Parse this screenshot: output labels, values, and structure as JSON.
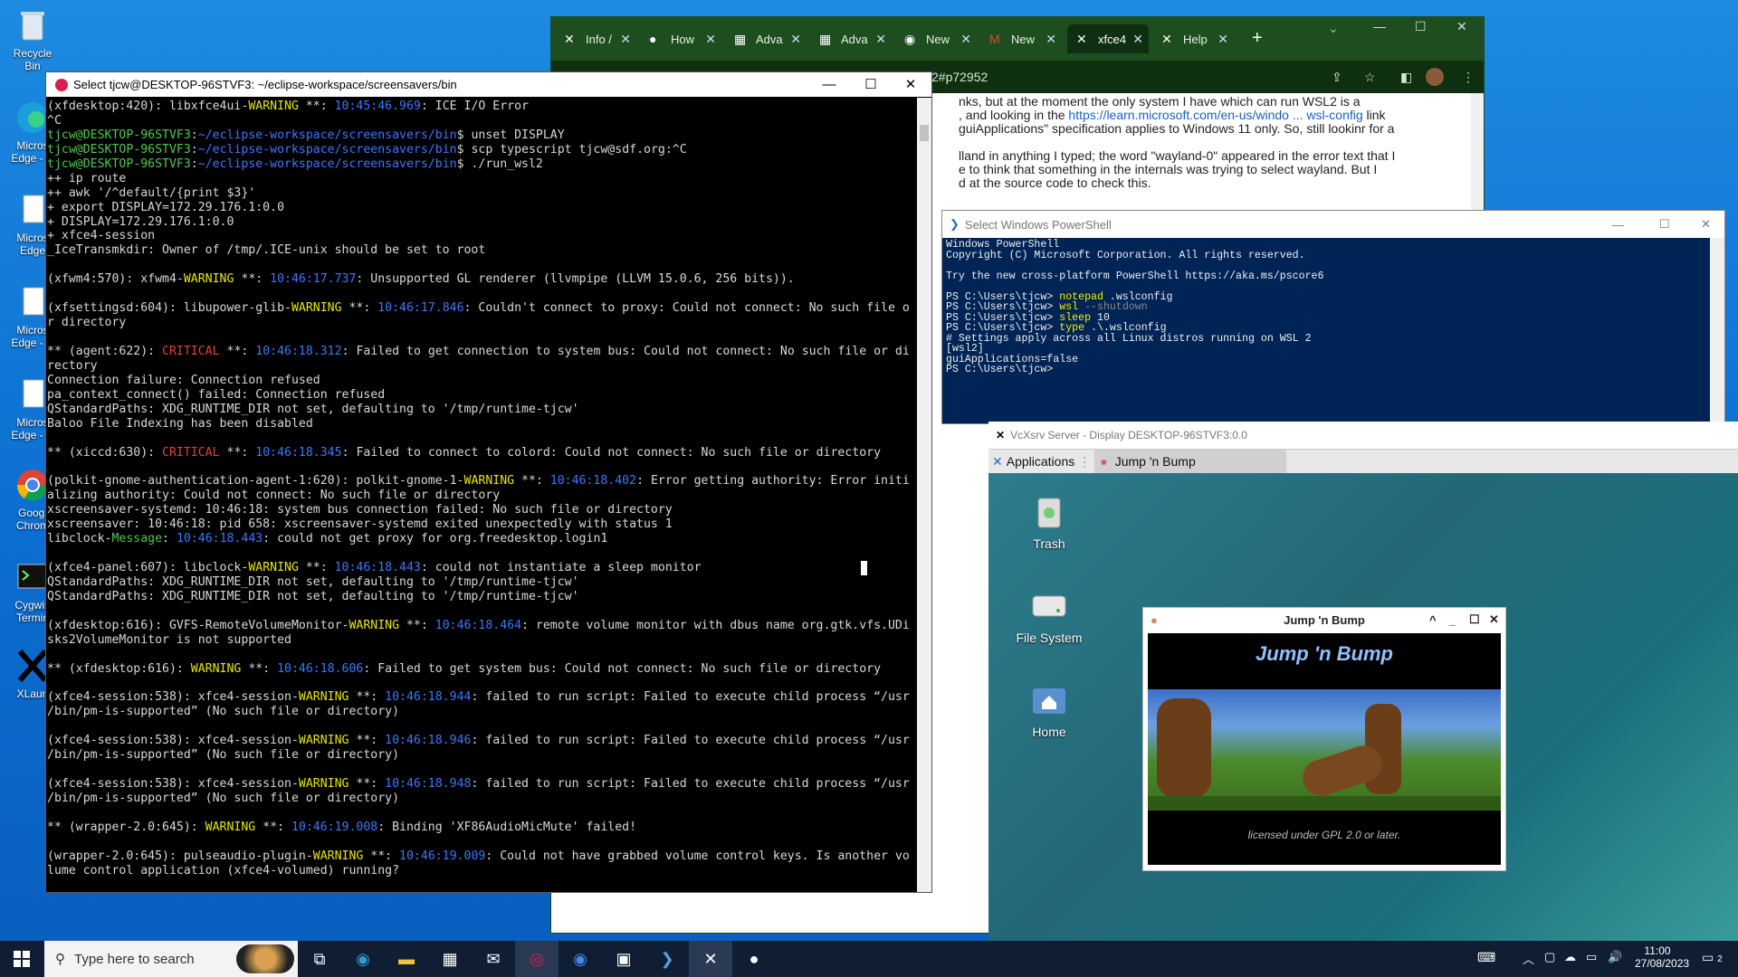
{
  "desktop": {
    "icons": [
      {
        "label": "Recycle Bin"
      },
      {
        "label": "Micros Edge - C"
      },
      {
        "label": "Micros Edge"
      },
      {
        "label": "Micros Edge - C"
      },
      {
        "label": "Micros Edge - C"
      },
      {
        "label": "Googl Chrom"
      },
      {
        "label": "Cygwin Termin"
      },
      {
        "label": "XLaun"
      }
    ]
  },
  "browser": {
    "tabs": [
      {
        "label": "Info /",
        "icon": "xfce-icon"
      },
      {
        "label": "How",
        "icon": "github-icon"
      },
      {
        "label": "Adva",
        "icon": "microsoft-icon"
      },
      {
        "label": "Adva",
        "icon": "microsoft-icon"
      },
      {
        "label": "New",
        "icon": "chrome-icon"
      },
      {
        "label": "New",
        "icon": "gmail-icon"
      },
      {
        "label": "xfce4",
        "icon": "xfce-icon"
      },
      {
        "label": "Help",
        "icon": "xfce-icon"
      }
    ],
    "address": "2#p72952",
    "content_lines": [
      "nks, but at the moment the only system I have which can run WSL2 is a",
      ", and looking in the",
      "https://learn.microsoft.com/en-us/windo ... wsl-config",
      "link",
      "guiApplications\" specification applies to Windows 11 only. So, still lookinr for a",
      "",
      "lland in anything I typed; the word \"wayland-0\" appeared in the error text that I",
      "e to think that something in the internals was trying to select wayland. But I",
      "d at the source code to check this."
    ]
  },
  "terminal": {
    "title": "Select tjcw@DESKTOP-96STVF3: ~/eclipse-workspace/screensavers/bin",
    "lines": [
      {
        "t": "(xfdesktop:420): libxfce4ui-WARNING **: 10:45:46.969: ICE I/O Error"
      },
      {
        "t": "^C"
      },
      {
        "t": "tjcw@DESKTOP-96STVF3:~/eclipse-workspace/screensavers/bin$ unset DISPLAY"
      },
      {
        "t": "tjcw@DESKTOP-96STVF3:~/eclipse-workspace/screensavers/bin$ scp typescript tjcw@sdf.org:^C"
      },
      {
        "t": "tjcw@DESKTOP-96STVF3:~/eclipse-workspace/screensavers/bin$ ./run_wsl2"
      },
      {
        "t": "++ ip route"
      },
      {
        "t": "++ awk '/^default/{print $3}'"
      },
      {
        "t": "+ export DISPLAY=172.29.176.1:0.0"
      },
      {
        "t": "+ DISPLAY=172.29.176.1:0.0"
      },
      {
        "t": "+ xfce4-session"
      },
      {
        "t": "_IceTransmkdir: Owner of /tmp/.ICE-unix should be set to root"
      },
      {
        "t": ""
      },
      {
        "t": "(xfwm4:570): xfwm4-WARNING **: 10:46:17.737: Unsupported GL renderer (llvmpipe (LLVM 15.0.6, 256 bits))."
      },
      {
        "t": ""
      },
      {
        "t": "(xfsettingsd:604): libupower-glib-WARNING **: 10:46:17.846: Couldn't connect to proxy: Could not connect: No such file o"
      },
      {
        "t": "r directory"
      },
      {
        "t": ""
      },
      {
        "t": "** (agent:622): CRITICAL **: 10:46:18.312: Failed to get connection to system bus: Could not connect: No such file or di"
      },
      {
        "t": "rectory"
      },
      {
        "t": "Connection failure: Connection refused"
      },
      {
        "t": "pa_context_connect() failed: Connection refused"
      },
      {
        "t": "QStandardPaths: XDG_RUNTIME_DIR not set, defaulting to '/tmp/runtime-tjcw'"
      },
      {
        "t": "Baloo File Indexing has been disabled"
      },
      {
        "t": ""
      },
      {
        "t": "** (xiccd:630): CRITICAL **: 10:46:18.345: Failed to connect to colord: Could not connect: No such file or directory"
      },
      {
        "t": ""
      },
      {
        "t": "(polkit-gnome-authentication-agent-1:620): polkit-gnome-1-WARNING **: 10:46:18.402: Error getting authority: Error initi"
      },
      {
        "t": "alizing authority: Could not connect: No such file or directory"
      },
      {
        "t": "xscreensaver-systemd: 10:46:18: system bus connection failed: No such file or directory"
      },
      {
        "t": "xscreensaver: 10:46:18: pid 658: xscreensaver-systemd exited unexpectedly with status 1"
      },
      {
        "t": "libclock-Message: 10:46:18.443: could not get proxy for org.freedesktop.login1"
      },
      {
        "t": ""
      },
      {
        "t": "(xfce4-panel:607): libclock-WARNING **: 10:46:18.443: could not instantiate a sleep monitor"
      },
      {
        "t": "QStandardPaths: XDG_RUNTIME_DIR not set, defaulting to '/tmp/runtime-tjcw'"
      },
      {
        "t": "QStandardPaths: XDG_RUNTIME_DIR not set, defaulting to '/tmp/runtime-tjcw'"
      },
      {
        "t": ""
      },
      {
        "t": "(xfdesktop:616): GVFS-RemoteVolumeMonitor-WARNING **: 10:46:18.464: remote volume monitor with dbus name org.gtk.vfs.UDi"
      },
      {
        "t": "sks2VolumeMonitor is not supported"
      },
      {
        "t": ""
      },
      {
        "t": "** (xfdesktop:616): WARNING **: 10:46:18.606: Failed to get system bus: Could not connect: No such file or directory"
      },
      {
        "t": ""
      },
      {
        "t": "(xfce4-session:538): xfce4-session-WARNING **: 10:46:18.944: failed to run script: Failed to execute child process “/usr"
      },
      {
        "t": "/bin/pm-is-supported” (No such file or directory)"
      },
      {
        "t": ""
      },
      {
        "t": "(xfce4-session:538): xfce4-session-WARNING **: 10:46:18.946: failed to run script: Failed to execute child process “/usr"
      },
      {
        "t": "/bin/pm-is-supported” (No such file or directory)"
      },
      {
        "t": ""
      },
      {
        "t": "(xfce4-session:538): xfce4-session-WARNING **: 10:46:18.948: failed to run script: Failed to execute child process “/usr"
      },
      {
        "t": "/bin/pm-is-supported” (No such file or directory)"
      },
      {
        "t": ""
      },
      {
        "t": "** (wrapper-2.0:645): WARNING **: 10:46:19.008: Binding 'XF86AudioMicMute' failed!"
      },
      {
        "t": ""
      },
      {
        "t": "(wrapper-2.0:645): pulseaudio-plugin-WARNING **: 10:46:19.009: Could not have grabbed volume control keys. Is another vo"
      },
      {
        "t": "lume control application (xfce4-volumed) running?"
      }
    ]
  },
  "powershell": {
    "title": "Select Windows PowerShell",
    "lines": [
      "Windows PowerShell",
      "Copyright (C) Microsoft Corporation. All rights reserved.",
      "",
      "Try the new cross-platform PowerShell https://aka.ms/pscore6",
      "",
      "PS C:\\Users\\tjcw> notepad .wslconfig",
      "PS C:\\Users\\tjcw> wsl --shutdown",
      "PS C:\\Users\\tjcw> sleep 10",
      "PS C:\\Users\\tjcw> type .\\.wslconfig",
      "# Settings apply across all Linux distros running on WSL 2",
      "[wsl2]",
      "guiApplications=false",
      "PS C:\\Users\\tjcw>"
    ]
  },
  "vcxsrv": {
    "title": "VcXsrv Server - Display DESKTOP-96STVF3:0.0",
    "applications_label": "Applications",
    "task_label": "Jump 'n Bump",
    "desktop_icons": [
      {
        "label": "Trash"
      },
      {
        "label": "File System"
      },
      {
        "label": "Home"
      }
    ],
    "game_window": {
      "title": "Jump 'n Bump",
      "logo_text": "Jump 'n Bump",
      "license": "licensed under GPL 2.0 or later."
    }
  },
  "taskbar": {
    "search_placeholder": "Type here to search",
    "time": "11:00",
    "date": "27/08/2023",
    "notification_count": "2"
  },
  "colors": {
    "terminal_warning": "#e5e510",
    "terminal_critical": "#e04040",
    "terminal_timestamp": "#3b78ff",
    "terminal_prompt_user": "#4ec94e",
    "terminal_prompt_path": "#3b78ff",
    "ps_background": "#012456",
    "ps_command": "#f0f000"
  }
}
